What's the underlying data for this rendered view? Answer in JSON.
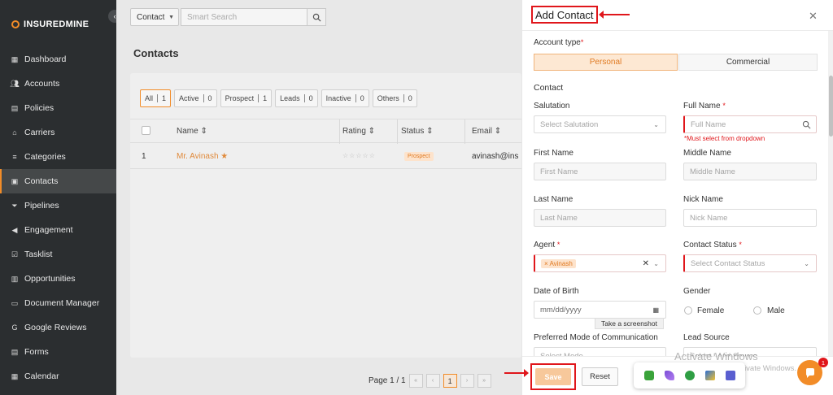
{
  "brand": {
    "name": "INSUREDMINE"
  },
  "sidebar": {
    "items": [
      {
        "label": "Dashboard"
      },
      {
        "label": "Accounts"
      },
      {
        "label": "Policies"
      },
      {
        "label": "Carriers"
      },
      {
        "label": "Categories"
      },
      {
        "label": "Contacts"
      },
      {
        "label": "Pipelines"
      },
      {
        "label": "Engagement"
      },
      {
        "label": "Tasklist"
      },
      {
        "label": "Opportunities"
      },
      {
        "label": "Document Manager"
      },
      {
        "label": "Google Reviews"
      },
      {
        "label": "Forms"
      },
      {
        "label": "Calendar"
      }
    ]
  },
  "topbar": {
    "filter_value": "Contact",
    "search_placeholder": "Smart Search"
  },
  "main": {
    "title": "Contacts",
    "chips": [
      {
        "label": "All",
        "count": "1"
      },
      {
        "label": "Active",
        "count": "0"
      },
      {
        "label": "Prospect",
        "count": "1"
      },
      {
        "label": "Leads",
        "count": "0"
      },
      {
        "label": "Inactive",
        "count": "0"
      },
      {
        "label": "Others",
        "count": "0"
      }
    ],
    "columns": {
      "name": "Name ⇕",
      "rating": "Rating ⇕",
      "status": "Status ⇕",
      "email": "Email ⇕"
    },
    "rows": [
      {
        "index": "1",
        "name": "Mr. Avinash",
        "rating": "☆☆☆☆☆",
        "status": "Prospect",
        "email": "avinash@ins"
      }
    ],
    "pager": {
      "label": "Page 1 / 1",
      "current": "1"
    }
  },
  "modal": {
    "title": "Add Contact",
    "account_type_label": "Account type",
    "account_types": [
      "Personal",
      "Commercial"
    ],
    "contact_section": "Contact",
    "fields": {
      "salutation": {
        "label": "Salutation",
        "placeholder": "Select Salutation"
      },
      "full_name": {
        "label": "Full Name",
        "placeholder": "Full Name",
        "error": "*Must select from dropdown"
      },
      "first_name": {
        "label": "First Name",
        "placeholder": "First Name"
      },
      "middle_name": {
        "label": "Middle Name",
        "placeholder": "Middle Name"
      },
      "last_name": {
        "label": "Last Name",
        "placeholder": "Last Name"
      },
      "nick_name": {
        "label": "Nick Name",
        "placeholder": "Nick Name"
      },
      "agent": {
        "label": "Agent",
        "tag": "Avinash"
      },
      "contact_status": {
        "label": "Contact Status",
        "placeholder": "Select Contact Status"
      },
      "dob": {
        "label": "Date of Birth",
        "placeholder": "mm/dd/yyyy"
      },
      "gender": {
        "label": "Gender",
        "options": [
          "Female",
          "Male"
        ]
      },
      "preferred_mode": {
        "label": "Preferred Mode of Communication",
        "placeholder": "Select Mode"
      },
      "lead_source": {
        "label": "Lead Source",
        "placeholder": "Select Lead Source"
      }
    },
    "tooltip": "Take a screenshot",
    "save_label": "Save",
    "reset_label": "Reset"
  },
  "overlay": {
    "watermark_title": "Activate Windows",
    "watermark_sub": "Go to Settings to activate Windows.",
    "chat_badge": "1"
  },
  "colors": {
    "accent": "#f28c28",
    "annotation": "#e0161b",
    "sidebar": "#2b2e30"
  }
}
